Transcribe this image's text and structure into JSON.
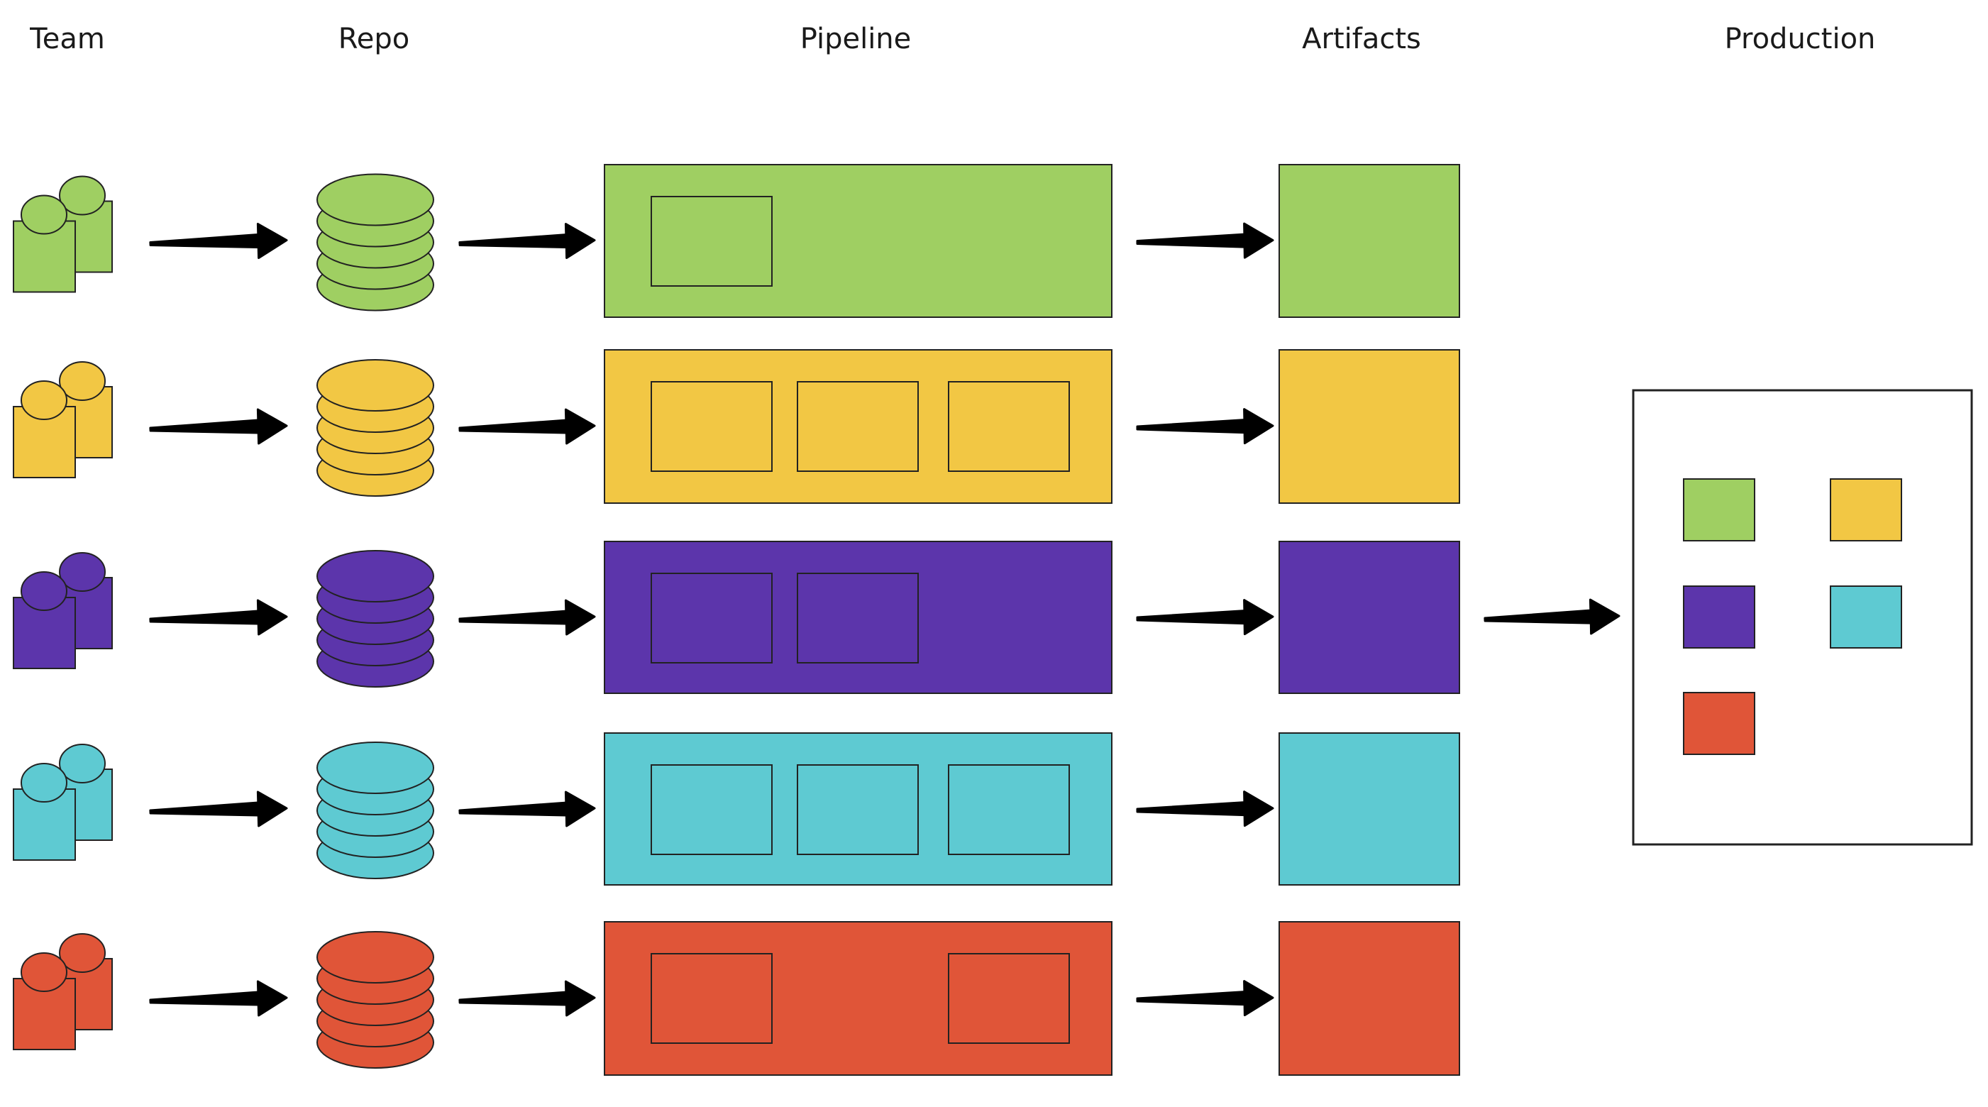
{
  "headers": {
    "team": "Team",
    "repo": "Repo",
    "pipeline": "Pipeline",
    "artifacts": "Artifacts",
    "production": "Production"
  },
  "rows": [
    {
      "name": "green",
      "color": "#9fcf62",
      "pipeline_stages": [
        true,
        false,
        false
      ]
    },
    {
      "name": "yellow",
      "color": "#f2c744",
      "pipeline_stages": [
        true,
        true,
        true
      ]
    },
    {
      "name": "purple",
      "color": "#5c35ab",
      "pipeline_stages": [
        true,
        true,
        false
      ]
    },
    {
      "name": "cyan",
      "color": "#5ecad2",
      "pipeline_stages": [
        true,
        true,
        true
      ]
    },
    {
      "name": "red",
      "color": "#e05538",
      "pipeline_stages": [
        true,
        false,
        true
      ]
    }
  ],
  "production": {
    "deployed": [
      "green",
      "yellow",
      "purple",
      "cyan",
      "red"
    ]
  }
}
